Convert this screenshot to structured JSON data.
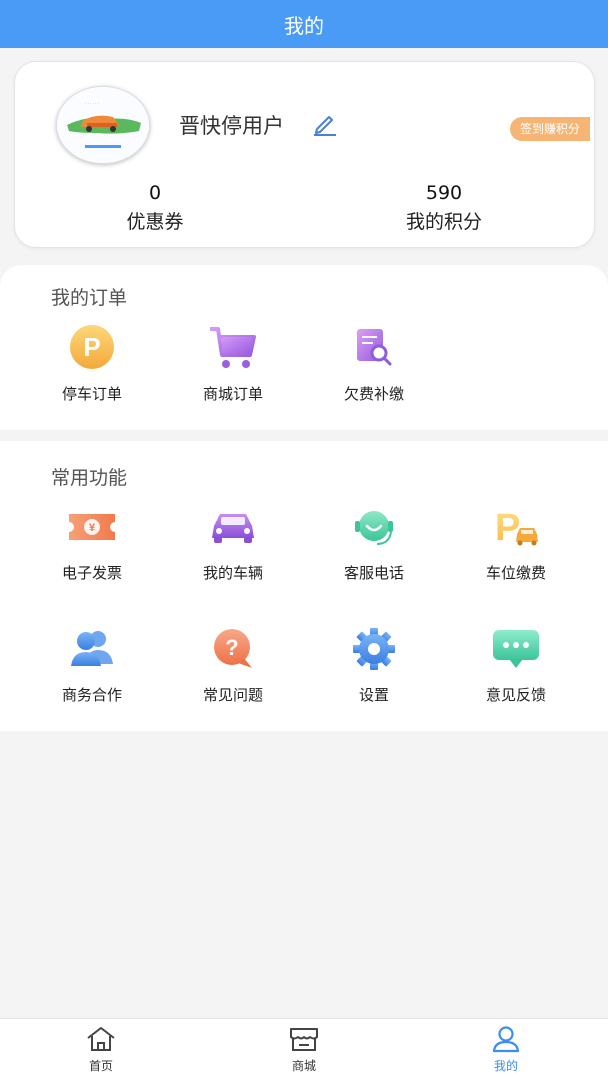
{
  "header": {
    "title": "我的"
  },
  "profile": {
    "username": "晋快停用户",
    "checkin_badge": "签到赚积分",
    "coupons": {
      "value": "0",
      "label": "优惠券"
    },
    "points": {
      "value": "590",
      "label": "我的积分"
    }
  },
  "orders": {
    "title": "我的订单",
    "items": [
      {
        "label": "停车订单",
        "icon": "parking-icon"
      },
      {
        "label": "商城订单",
        "icon": "cart-icon"
      },
      {
        "label": "欠费补缴",
        "icon": "document-search-icon"
      }
    ]
  },
  "common": {
    "title": "常用功能",
    "items": [
      {
        "label": "电子发票",
        "icon": "invoice-ticket-icon"
      },
      {
        "label": "我的车辆",
        "icon": "car-icon"
      },
      {
        "label": "客服电话",
        "icon": "headset-icon"
      },
      {
        "label": "车位缴费",
        "icon": "parking-car-icon"
      },
      {
        "label": "商务合作",
        "icon": "users-icon"
      },
      {
        "label": "常见问题",
        "icon": "question-bubble-icon"
      },
      {
        "label": "设置",
        "icon": "gear-icon"
      },
      {
        "label": "意见反馈",
        "icon": "chat-bubble-icon"
      }
    ]
  },
  "tabbar": {
    "items": [
      {
        "label": "首页",
        "icon": "home-icon"
      },
      {
        "label": "商城",
        "icon": "store-icon"
      },
      {
        "label": "我的",
        "icon": "user-icon",
        "active": true
      }
    ]
  },
  "colors": {
    "primary": "#4a9bf5",
    "badge": "#f7b575",
    "active_tab": "#3a8ef0"
  }
}
